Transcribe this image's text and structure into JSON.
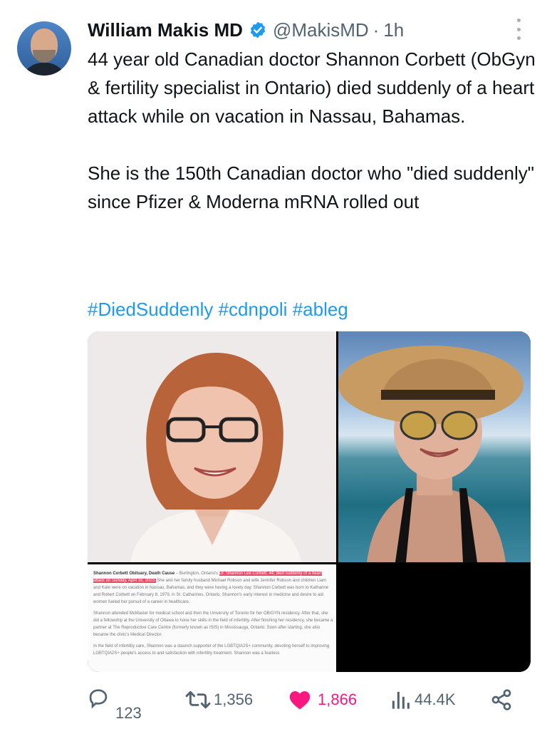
{
  "author": {
    "name": "William Makis MD",
    "handle": "@MakisMD",
    "separator": "·",
    "time": "1h"
  },
  "tweet": {
    "paragraph1": "44 year old Canadian doctor Shannon Corbett (ObGyn & fertility specialist in Ontario) died suddenly of a heart attack while on vacation in Nassau, Bahamas.",
    "paragraph2": "She is the 150th Canadian doctor who \"died suddenly\" since Pfizer & Moderna mRNA rolled out",
    "hashtags": [
      "#DiedSuddenly",
      "#cdnpoli",
      "#ableg"
    ]
  },
  "media": {
    "doc": {
      "heading": "Shannon Corbett Obituary, Death Cause",
      "para1_a": " – Burlington, Ontario's ",
      "para1_hl1": "Dr. Shannon Lee Corbett, 44, died suddenly of a heart attack on Sunday, April 16, 2023.",
      "para1_b": " She and her family husband Michael Robson and wife Jennifer Robson and children Liam and Kate were on vacation in Nassau, Bahamas, and they were having a lovely day. Shannon Corbett was born to Katharine and Robert Corbett on February 8, 1979, in St. Catharines, Ontario. Shannon's early interest in medicine and desire to aid women fueled her pursuit of a career in healthcare.",
      "para2": "Shannon attended McMaster for medical school and then the University of Toronto for her OB/GYN residency. After that, she did a fellowship at the University of Ottawa to hone her skills in the field of infertility. After finishing her residency, she became a partner at The Reproductive Care Centre (formerly known as ISIS) in Mississauga, Ontario. Soon after starting, she also became the clinic's Medical Director.",
      "para3": "In the field of infertility care, Shannon was a staunch supporter of the LGBTQIA2S+ community, devoting herself to improving LGBTQIA2S+ people's access to and satisfaction with infertility treatment. Shannon was a fearless"
    }
  },
  "actions": {
    "replies": "123",
    "reposts": "1,356",
    "likes": "1,866",
    "views": "44.4K"
  },
  "colors": {
    "accent": "#1d9bf0",
    "like": "#f91880",
    "muted": "#536471",
    "highlight": "#e74c67"
  },
  "icons": [
    "verified-badge-icon",
    "more-options-icon",
    "reply-icon",
    "repost-icon",
    "like-icon",
    "views-icon",
    "share-icon"
  ]
}
